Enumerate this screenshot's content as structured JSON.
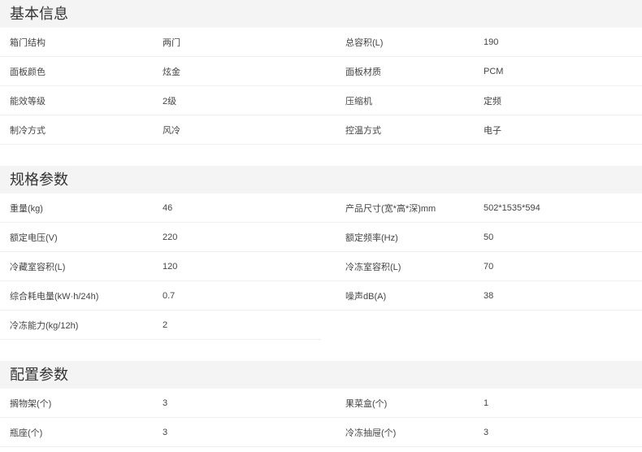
{
  "sections": [
    {
      "title": "基本信息",
      "rows": [
        [
          {
            "label": "箱门结构",
            "value": "两门"
          },
          {
            "label": "总容积(L)",
            "value": "190"
          }
        ],
        [
          {
            "label": "面板颜色",
            "value": "炫金"
          },
          {
            "label": "面板材质",
            "value": "PCM"
          }
        ],
        [
          {
            "label": "能效等级",
            "value": "2级"
          },
          {
            "label": "压缩机",
            "value": "定频"
          }
        ],
        [
          {
            "label": "制冷方式",
            "value": "风冷"
          },
          {
            "label": "控温方式",
            "value": "电子"
          }
        ]
      ]
    },
    {
      "title": "规格参数",
      "rows": [
        [
          {
            "label": "重量(kg)",
            "value": "46"
          },
          {
            "label": "产品尺寸(宽*高*深)mm",
            "value": "502*1535*594"
          }
        ],
        [
          {
            "label": "额定电压(V)",
            "value": "220"
          },
          {
            "label": "额定频率(Hz)",
            "value": "50"
          }
        ],
        [
          {
            "label": "冷藏室容积(L)",
            "value": "120"
          },
          {
            "label": "冷冻室容积(L)",
            "value": "70"
          }
        ],
        [
          {
            "label": "综合耗电量(kW·h/24h)",
            "value": "0.7"
          },
          {
            "label": "噪声dB(A)",
            "value": "38"
          }
        ],
        [
          {
            "label": "冷冻能力(kg/12h)",
            "value": "2"
          },
          {
            "label": "",
            "value": ""
          }
        ]
      ]
    },
    {
      "title": "配置参数",
      "rows": [
        [
          {
            "label": "搁物架(个)",
            "value": "3"
          },
          {
            "label": "果菜盒(个)",
            "value": "1"
          }
        ],
        [
          {
            "label": "瓶座(个)",
            "value": "3"
          },
          {
            "label": "冷冻抽屉(个)",
            "value": "3"
          }
        ]
      ]
    }
  ]
}
